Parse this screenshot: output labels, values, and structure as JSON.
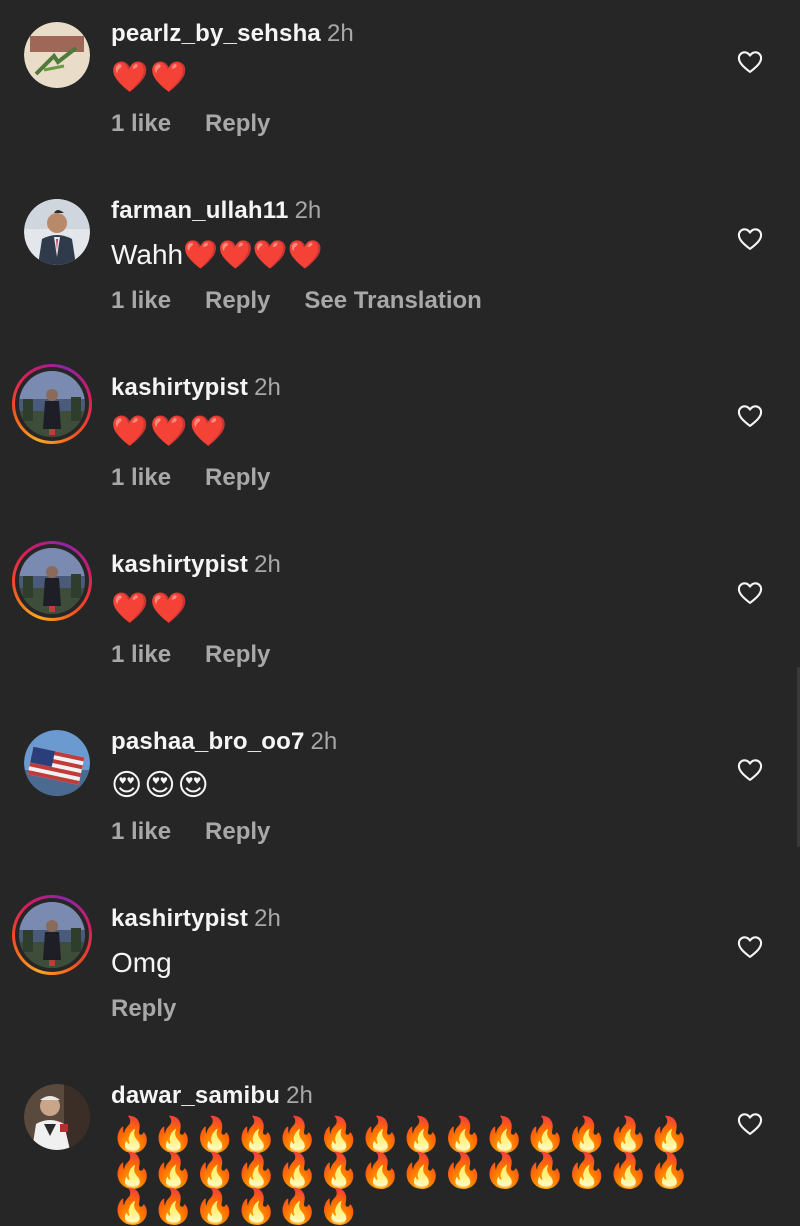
{
  "comments": [
    {
      "username": "pearlz_by_sehsha",
      "time": "2h",
      "text": "❤️❤️",
      "likes": "1 like",
      "reply": "Reply",
      "translate": ""
    },
    {
      "username": "farman_ullah11",
      "time": "2h",
      "text": "Wahh❤️❤️❤️❤️",
      "likes": "1 like",
      "reply": "Reply",
      "translate": "See Translation"
    },
    {
      "username": "kashirtypist",
      "time": "2h",
      "text": "❤️❤️❤️",
      "likes": "1 like",
      "reply": "Reply",
      "translate": ""
    },
    {
      "username": "kashirtypist",
      "time": "2h",
      "text": "❤️❤️",
      "likes": "1 like",
      "reply": "Reply",
      "translate": ""
    },
    {
      "username": "pashaa_bro_oo7",
      "time": "2h",
      "text": "😍😍😍",
      "likes": "1 like",
      "reply": "Reply",
      "translate": ""
    },
    {
      "username": "kashirtypist",
      "time": "2h",
      "text": "Omg",
      "likes": "",
      "reply": "Reply",
      "translate": ""
    },
    {
      "username": "dawar_samibu",
      "time": "2h",
      "text": "🔥🔥🔥🔥🔥🔥🔥🔥🔥🔥🔥🔥🔥🔥🔥🔥🔥🔥🔥🔥🔥🔥🔥🔥🔥🔥🔥🔥🔥🔥🔥🔥🔥🔥",
      "likes": "",
      "reply": "",
      "translate": ""
    }
  ],
  "icons": {
    "like": "heart-outline-icon"
  },
  "colors": {
    "background": "#262626",
    "primary_text": "#f5f5f5",
    "secondary_text": "#a8a8a8",
    "story_ring_start": "#f9a825",
    "story_ring_end": "#d81b60"
  }
}
